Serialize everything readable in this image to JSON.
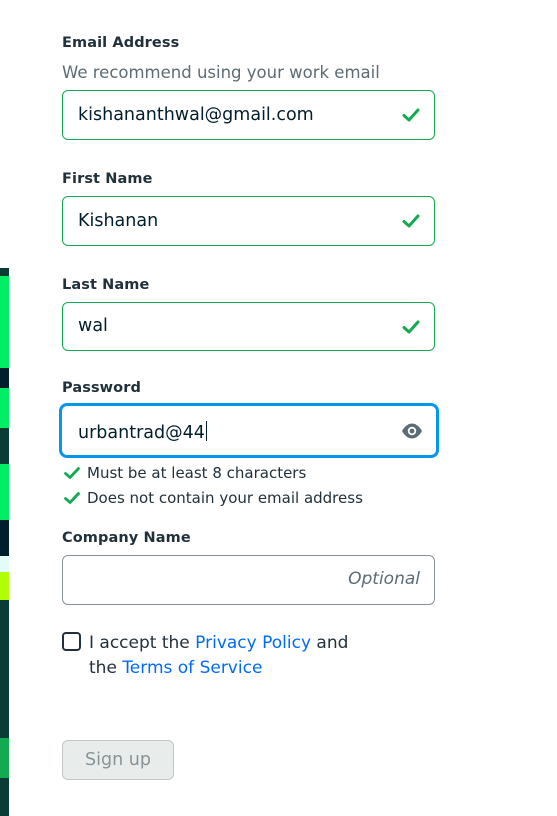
{
  "form": {
    "email": {
      "label": "Email Address",
      "hint": "We recommend using your work email",
      "value": "kishananthwal@gmail.com",
      "valid": true
    },
    "first_name": {
      "label": "First Name",
      "value": "Kishanan",
      "valid": true
    },
    "last_name": {
      "label": "Last Name",
      "value": "wal",
      "valid": true
    },
    "password": {
      "label": "Password",
      "value": "urbantrad@44",
      "rules": [
        "Must be at least 8 characters",
        "Does not contain your email address"
      ]
    },
    "company": {
      "label": "Company Name",
      "placeholder": "Optional",
      "value": ""
    },
    "consent": {
      "prefix": "I accept the",
      "privacy_link": "Privacy Policy",
      "middle": "and",
      "line2_prefix": "the",
      "terms_link": "Terms of Service",
      "checked": false
    },
    "submit_label": "Sign up"
  },
  "icons": {
    "check": "check-icon",
    "eye": "eye-icon"
  },
  "colors": {
    "valid_green": "#13aa52",
    "focus_blue": "#0498ec",
    "link_blue": "#016bf8"
  }
}
